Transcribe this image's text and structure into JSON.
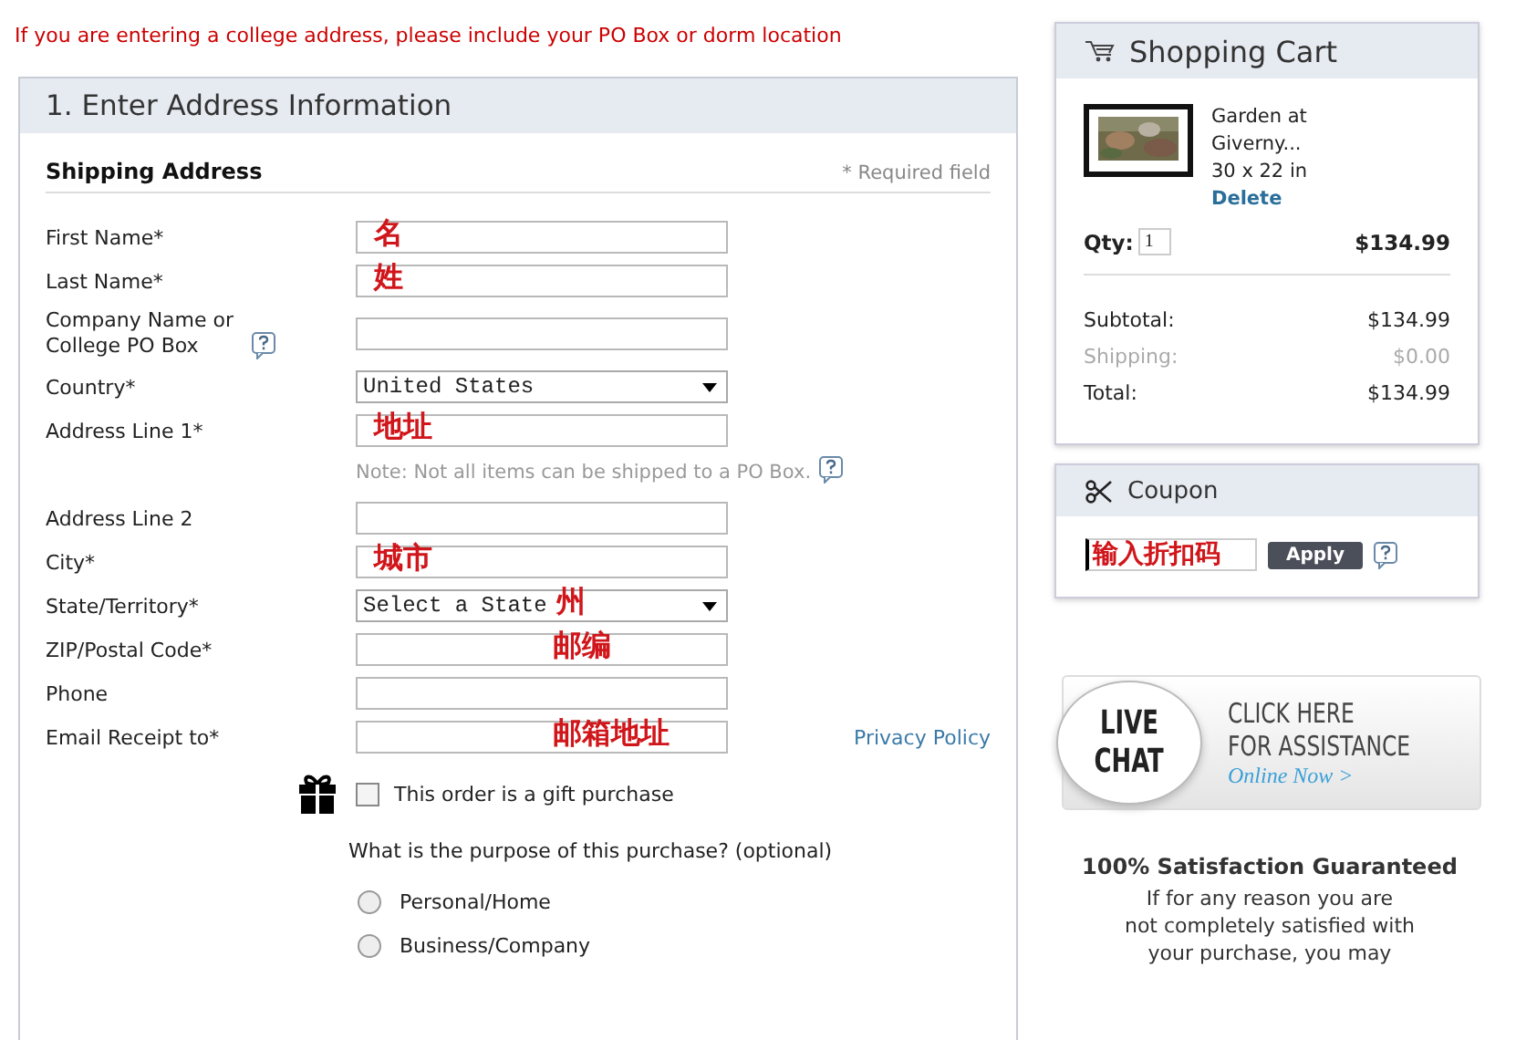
{
  "notice": "If you are entering a college address, please include your PO Box or dorm location",
  "section": {
    "title": "1. Enter Address Information",
    "subtitle": "Shipping Address",
    "required_note": "* Required field"
  },
  "fields": [
    {
      "kind": "text",
      "label": "First Name*",
      "annotation": "名"
    },
    {
      "kind": "text",
      "label": "Last Name*",
      "annotation": "姓"
    },
    {
      "kind": "text",
      "label": "Company Name or College PO Box",
      "help": true
    },
    {
      "kind": "select",
      "label": "Country*",
      "value": "United States"
    },
    {
      "kind": "text",
      "label": "Address Line 1*",
      "annotation": "地址"
    },
    {
      "kind": "note",
      "text": "Note: Not all items can be shipped to a PO Box.",
      "help": true
    },
    {
      "kind": "text",
      "label": "Address Line 2"
    },
    {
      "kind": "text",
      "label": "City*",
      "annotation": "城市"
    },
    {
      "kind": "select",
      "label": "State/Territory*",
      "value": "Select a State",
      "annotation": "州"
    },
    {
      "kind": "text",
      "label": "ZIP/Postal Code*",
      "annotation": "邮编",
      "centered": true
    },
    {
      "kind": "text",
      "label": "Phone"
    },
    {
      "kind": "text",
      "label": "Email Receipt to*",
      "annotation": "邮箱地址",
      "centered": true,
      "link": "Privacy Policy"
    }
  ],
  "gift": {
    "label": "This order is a gift purchase",
    "checked": false
  },
  "purpose": {
    "question": "What is the purpose of this purchase? (optional)",
    "options": [
      {
        "label": "Personal/Home",
        "selected": false
      },
      {
        "label": "Business/Company",
        "selected": false
      }
    ]
  },
  "cart": {
    "title": "Shopping Cart",
    "item": {
      "kind": "picture",
      "name": "Garden at Giverny...",
      "size": "30 x 22 in",
      "delete": "Delete"
    },
    "qty_label": "Qty:",
    "qty": "1",
    "line_price": "$134.99",
    "totals": [
      {
        "label": "Subtotal:",
        "value": "$134.99",
        "muted": false
      },
      {
        "label": "Shipping:",
        "value": "$0.00",
        "muted": true
      },
      {
        "label": "Total:",
        "value": "$134.99",
        "muted": false
      }
    ]
  },
  "coupon": {
    "title": "Coupon",
    "value": "输入折扣码",
    "button": "Apply"
  },
  "chat": {
    "bubble": [
      "LIVE",
      "CHAT"
    ],
    "lines": [
      "CLICK HERE",
      "FOR ASSISTANCE"
    ],
    "status": "Online Now >"
  },
  "guarantee": {
    "title": "100% Satisfaction Guaranteed",
    "lines": [
      "If for any reason you are",
      "not completely satisfied with",
      "your purchase, you may"
    ]
  }
}
